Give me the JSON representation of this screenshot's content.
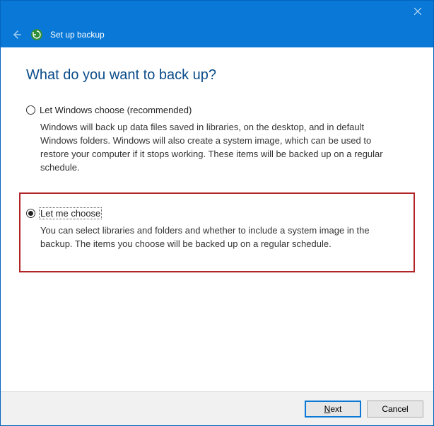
{
  "titlebar": {
    "close_tooltip": "Close"
  },
  "header": {
    "title": "Set up backup"
  },
  "main": {
    "heading": "What do you want to back up?",
    "options": [
      {
        "label": "Let Windows choose (recommended)",
        "description": "Windows will back up data files saved in libraries, on the desktop, and in default Windows folders. Windows will also create a system image, which can be used to restore your computer if it stops working. These items will be backed up on a regular schedule.",
        "checked": false
      },
      {
        "label": "Let me choose",
        "description": "You can select libraries and folders and whether to include a system image in the backup. The items you choose will be backed up on a regular schedule.",
        "checked": true
      }
    ]
  },
  "footer": {
    "next_label": "Next",
    "cancel_label": "Cancel"
  }
}
